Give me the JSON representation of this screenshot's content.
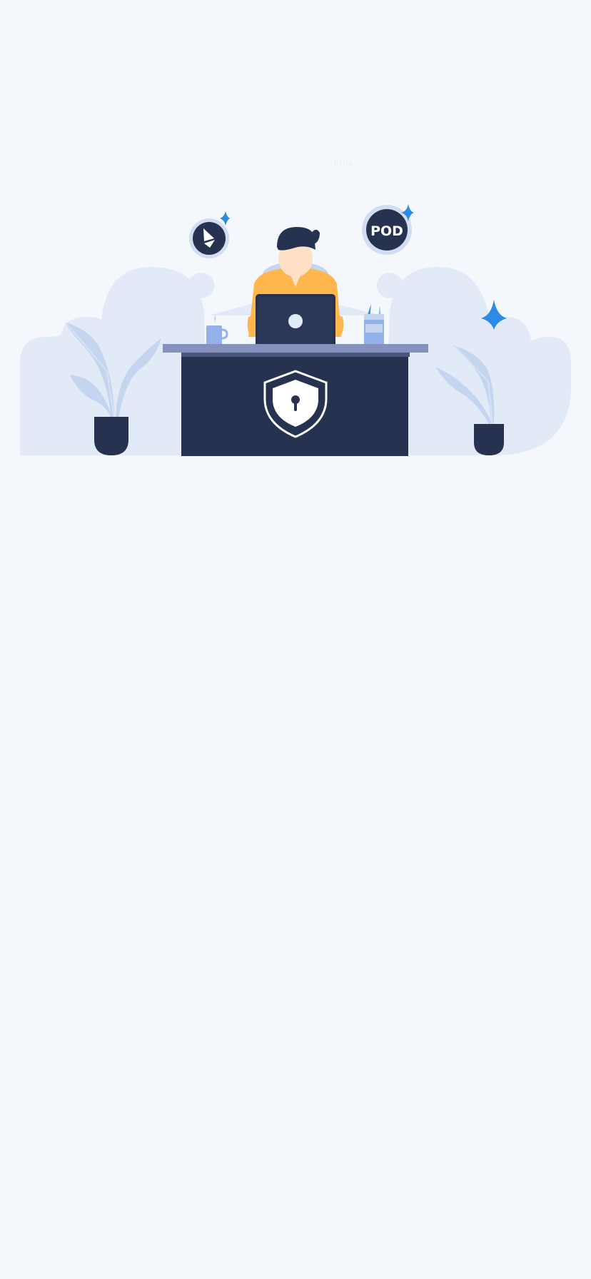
{
  "screen": {
    "background_color": "#f4f8fc",
    "faint_label": "Ethe"
  },
  "illustration": {
    "pod_token_label": "POD",
    "eth_token_icon": "ethereum-icon",
    "desk_badge_icon": "shield-lock-icon",
    "laptop_logo_icon": "laptop-logo-icon",
    "colors": {
      "navy": "#273250",
      "blob": "#e2e9f7",
      "accent_blue": "#2b8be6",
      "shirt": "#ffb74d",
      "skin": "#ffe1c6",
      "desk_top": "#8692bd"
    }
  }
}
